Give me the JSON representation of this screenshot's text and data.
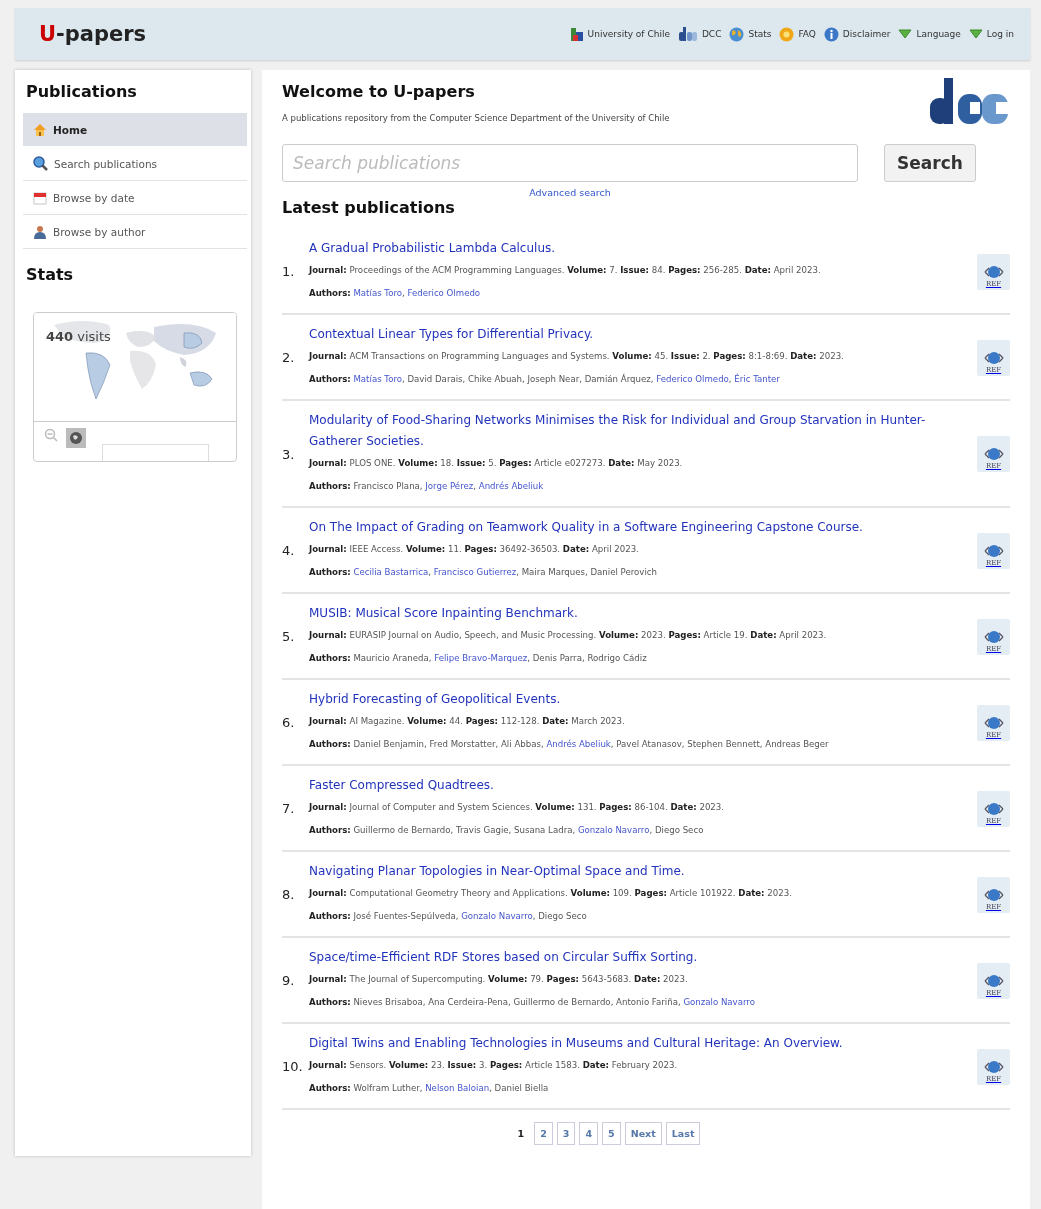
{
  "header": {
    "site_title": "U-papers",
    "links": [
      {
        "label": "University of Chile",
        "kind": "university"
      },
      {
        "label": "DCC",
        "kind": "dcc"
      },
      {
        "label": "Stats",
        "kind": "stats"
      },
      {
        "label": "FAQ",
        "kind": "faq"
      },
      {
        "label": "Disclaimer",
        "kind": "info"
      },
      {
        "label": "Language",
        "kind": "menu"
      },
      {
        "label": "Log in",
        "kind": "menu"
      }
    ]
  },
  "sidebar": {
    "title": "Publications",
    "items": [
      {
        "label": "Home",
        "kind": "home",
        "selected": true
      },
      {
        "label": "Search publications",
        "kind": "search",
        "selected": false
      },
      {
        "label": "Browse by date",
        "kind": "calendar",
        "selected": false
      },
      {
        "label": "Browse by author",
        "kind": "person",
        "selected": false
      }
    ],
    "stats_title": "Stats",
    "visits": "440 visits"
  },
  "main": {
    "title": "Welcome to U-papers",
    "subtitle": "A publications repository from the Computer Science Department of the University of Chile",
    "search": {
      "placeholder": "Search publications",
      "button": "Search",
      "advanced": "Advanced search"
    },
    "latest_title": "Latest publications",
    "publications": [
      {
        "number": "1.",
        "title": "A Gradual Probabilistic Lambda Calculus.",
        "details": "**Journal:** Proceedings of the ACM Programming Languages. **Volume:** 7. **Issue:** 84. **Pages:** 256-285. **Date:** April 2023.",
        "authors_label": "Authors:",
        "authors": [
          {
            "text": "Matías Toro",
            "kind": "link"
          },
          {
            "text": ", ",
            "kind": "text"
          },
          {
            "text": "Federico Olmedo",
            "kind": "link"
          }
        ],
        "ref": "REF"
      },
      {
        "number": "2.",
        "title": "Contextual Linear Types for Differential Privacy.",
        "details": "**Journal:** ACM Transactions on Programming Languages and Systems. **Volume:** 45. **Issue:** 2. **Pages:** 8:1-8:69. **Date:** 2023.",
        "authors_label": "Authors:",
        "authors": [
          {
            "text": "Matías Toro",
            "kind": "link"
          },
          {
            "text": ", David Darais, Chike Abuah, Joseph Near, Damián Árquez, ",
            "kind": "text"
          },
          {
            "text": "Federico Olmedo",
            "kind": "link"
          },
          {
            "text": ", ",
            "kind": "text"
          },
          {
            "text": "Éric Tanter",
            "kind": "link"
          }
        ],
        "ref": "REF"
      },
      {
        "number": "3.",
        "title": "Modularity of Food-Sharing Networks Minimises the Risk for Individual and Group Starvation in Hunter-Gatherer Societies.",
        "details": "**Journal:** PLOS ONE. **Volume:** 18. **Issue:** 5. **Pages:** Article e027273. **Date:** May 2023.",
        "authors_label": "Authors:",
        "authors": [
          {
            "text": "Francisco Plana, ",
            "kind": "text"
          },
          {
            "text": "Jorge Pérez",
            "kind": "link"
          },
          {
            "text": ", ",
            "kind": "text"
          },
          {
            "text": "Andrés Abeliuk",
            "kind": "link"
          }
        ],
        "ref": "REF"
      },
      {
        "number": "4.",
        "title": "On The Impact of Grading on Teamwork Quality in a Software Engineering Capstone Course.",
        "details": "**Journal:** IEEE Access. **Volume:** 11. **Pages:** 36492-36503. **Date:** April 2023.",
        "authors_label": "Authors:",
        "authors": [
          {
            "text": "Cecilia Bastarrica",
            "kind": "link"
          },
          {
            "text": ", ",
            "kind": "text"
          },
          {
            "text": "Francisco Gutierrez",
            "kind": "link"
          },
          {
            "text": ", Maira Marques, Daniel Perovich",
            "kind": "text"
          }
        ],
        "ref": "REF"
      },
      {
        "number": "5.",
        "title": "MUSIB: Musical Score Inpainting Benchmark.",
        "details": "**Journal:** EURASIP Journal on Audio, Speech, and Music Processing. **Volume:** 2023. **Pages:** Article 19. **Date:** April 2023.",
        "authors_label": "Authors:",
        "authors": [
          {
            "text": "Mauricio Araneda, ",
            "kind": "text"
          },
          {
            "text": "Felipe Bravo-Marquez",
            "kind": "link"
          },
          {
            "text": ", Denis Parra, Rodrigo Cádiz",
            "kind": "text"
          }
        ],
        "ref": "REF"
      },
      {
        "number": "6.",
        "title": "Hybrid Forecasting of Geopolitical Events.",
        "details": "**Journal:** AI Magazine. **Volume:** 44. **Pages:** 112-128. **Date:** March 2023.",
        "authors_label": "Authors:",
        "authors": [
          {
            "text": "Daniel Benjamin, Fred Morstatter, Ali Abbas, ",
            "kind": "text"
          },
          {
            "text": "Andrés Abeliuk",
            "kind": "link"
          },
          {
            "text": ", Pavel Atanasov, Stephen Bennett, Andreas Beger",
            "kind": "text"
          }
        ],
        "ref": "REF"
      },
      {
        "number": "7.",
        "title": "Faster Compressed Quadtrees.",
        "details": "**Journal:** Journal of Computer and System Sciences. **Volume:** 131. **Pages:** 86-104. **Date:** 2023.",
        "authors_label": "Authors:",
        "authors": [
          {
            "text": "Guillermo de Bernardo, Travis Gagie, Susana Ladra, ",
            "kind": "text"
          },
          {
            "text": "Gonzalo Navarro",
            "kind": "link"
          },
          {
            "text": ", Diego Seco",
            "kind": "text"
          }
        ],
        "ref": "REF"
      },
      {
        "number": "8.",
        "title": "Navigating Planar Topologies in Near-Optimal Space and Time.",
        "details": "**Journal:** Computational Geometry Theory and Applications. **Volume:** 109. **Pages:** Article 101922. **Date:** 2023.",
        "authors_label": "Authors:",
        "authors": [
          {
            "text": "José Fuentes-Sepúlveda, ",
            "kind": "text"
          },
          {
            "text": "Gonzalo Navarro",
            "kind": "link"
          },
          {
            "text": ", Diego Seco",
            "kind": "text"
          }
        ],
        "ref": "REF"
      },
      {
        "number": "9.",
        "title": "Space/time-Efficient RDF Stores based on Circular Suffix Sorting.",
        "details": "**Journal:** The Journal of Supercomputing. **Volume:** 79. **Pages:** 5643-5683. **Date:** 2023.",
        "authors_label": "Authors:",
        "authors": [
          {
            "text": "Nieves Brisaboa, Ana Cerdeira-Pena, Guillermo de Bernardo, Antonio Fariña, ",
            "kind": "text"
          },
          {
            "text": "Gonzalo Navarro",
            "kind": "link"
          }
        ],
        "ref": "REF"
      },
      {
        "number": "10.",
        "title": "Digital Twins and Enabling Technologies in Museums and Cultural Heritage: An Overview.",
        "details": "**Journal:** Sensors. **Volume:** 23. **Issue:** 3. **Pages:** Article 1583. **Date:** February 2023.",
        "authors_label": "Authors:",
        "authors": [
          {
            "text": "Wolfram Luther, ",
            "kind": "text"
          },
          {
            "text": "Nelson Baloian",
            "kind": "link"
          },
          {
            "text": ", Daniel Biella",
            "kind": "text"
          }
        ],
        "ref": "REF"
      }
    ],
    "pagination": [
      {
        "label": "1",
        "selected": true
      },
      {
        "label": "2",
        "selected": false
      },
      {
        "label": "3",
        "selected": false
      },
      {
        "label": "4",
        "selected": false
      },
      {
        "label": "5",
        "selected": false
      },
      {
        "label": "Next",
        "selected": false
      },
      {
        "label": "Last",
        "selected": false
      }
    ]
  }
}
